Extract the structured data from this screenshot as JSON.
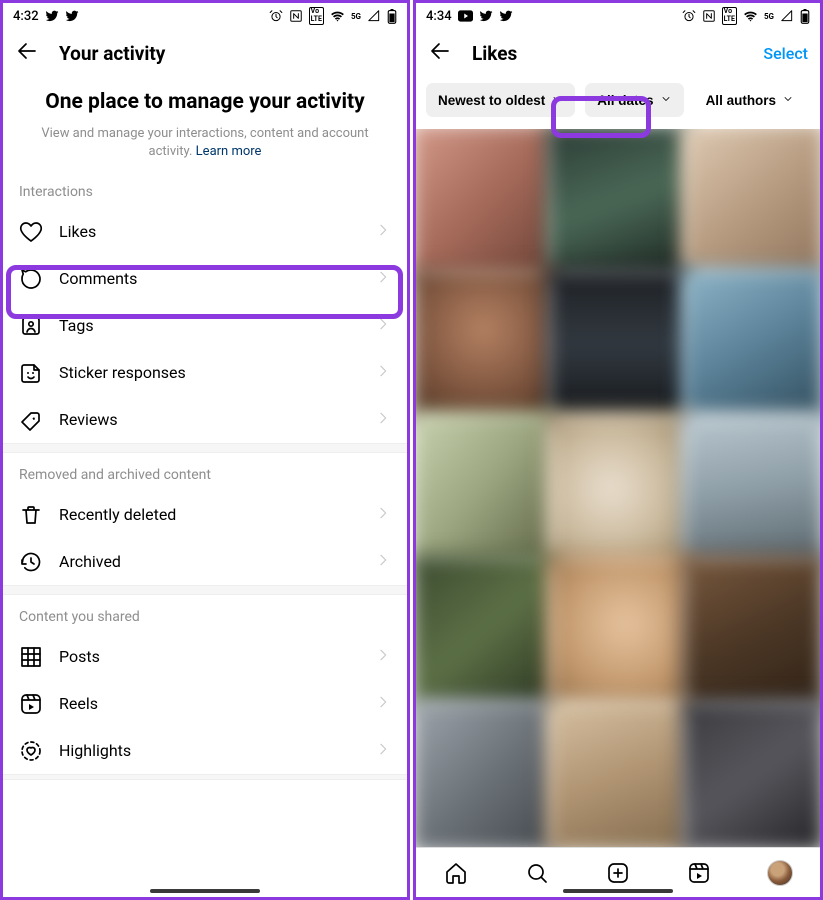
{
  "left": {
    "status": {
      "time": "4:32"
    },
    "header": {
      "title": "Your activity"
    },
    "intro": {
      "title": "One place to manage your activity",
      "subtitle": "View and manage your interactions, content and account activity.",
      "link": "Learn more"
    },
    "sections": {
      "interactions": {
        "label": "Interactions",
        "items": {
          "likes": "Likes",
          "comments": "Comments",
          "tags": "Tags",
          "stickers": "Sticker responses",
          "reviews": "Reviews"
        }
      },
      "removed": {
        "label": "Removed and archived content",
        "items": {
          "deleted": "Recently deleted",
          "archived": "Archived"
        }
      },
      "shared": {
        "label": "Content you shared",
        "items": {
          "posts": "Posts",
          "reels": "Reels",
          "highlights": "Highlights"
        }
      }
    }
  },
  "right": {
    "status": {
      "time": "4:34"
    },
    "header": {
      "title": "Likes",
      "action": "Select"
    },
    "filters": {
      "sort": "Newest to oldest",
      "dates": "All dates",
      "authors": "All authors"
    }
  },
  "status_icons": {
    "volte": "VoLTE",
    "fiveG": "5G"
  }
}
